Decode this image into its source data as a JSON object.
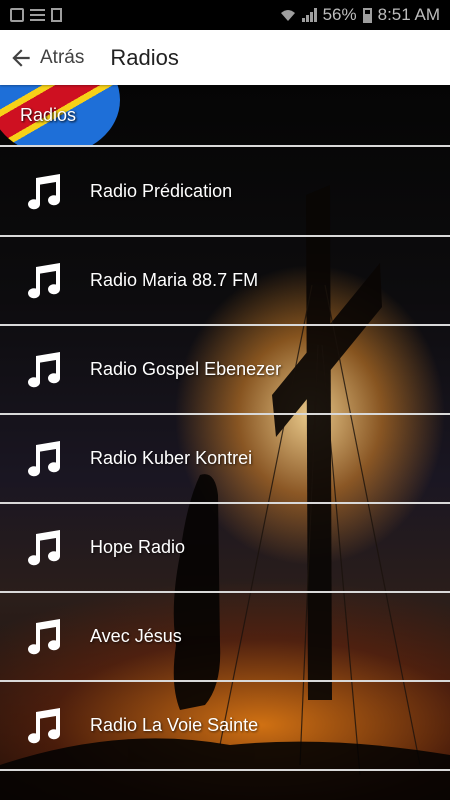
{
  "status_bar": {
    "battery_percent": "56%",
    "time": "8:51 AM",
    "icons": [
      "gallery-icon",
      "list-icon",
      "doc-icon",
      "wifi-icon",
      "signal-icon",
      "battery-icon"
    ]
  },
  "app_bar": {
    "back_label": "Atrás",
    "title": "Radios"
  },
  "banner": {
    "title": "Radios"
  },
  "colors": {
    "app_bar_bg": "#ffffff",
    "list_text": "#ffffff",
    "divider": "#d9d9d9"
  },
  "radios": [
    {
      "label": "Radio Prédication",
      "icon": "music-note-icon"
    },
    {
      "label": "Radio Maria 88.7 FM",
      "icon": "music-note-icon"
    },
    {
      "label": "Radio Gospel Ebenezer",
      "icon": "music-note-icon"
    },
    {
      "label": "Radio Kuber Kontrei",
      "icon": "music-note-icon"
    },
    {
      "label": "Hope Radio",
      "icon": "music-note-icon"
    },
    {
      "label": "Avec Jésus",
      "icon": "music-note-icon"
    },
    {
      "label": "Radio La Voie Sainte",
      "icon": "music-note-icon"
    }
  ]
}
